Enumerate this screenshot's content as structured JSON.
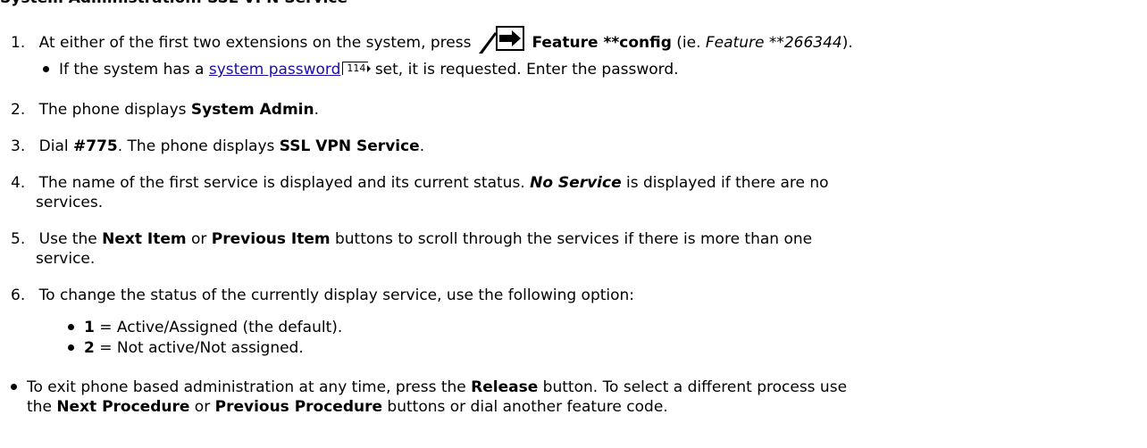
{
  "heading_cut": "System Administration: SSL VPN Service",
  "steps": [
    {
      "num": "1.",
      "pre": "At either of the first two extensions on the system, press",
      "feature_bold": "Feature **config",
      "paren_open": " (ie. ",
      "paren_italic": "Feature **266344",
      "paren_close": ")."
    },
    {
      "num": "2.",
      "pre": "The phone displays ",
      "bold": "System Admin",
      "post": "."
    },
    {
      "num": "3.",
      "pre": "Dial ",
      "bold": "#775",
      "mid": ". The phone displays ",
      "bold2": "SSL VPN Service",
      "post": "."
    },
    {
      "num": "4.",
      "pre": "The name of the first service is displayed and its current status. ",
      "bolditalic": "No Service",
      "post": " is displayed if there are no",
      "line2": "services."
    },
    {
      "num": "5.",
      "pre": "Use the ",
      "bold": "Next Item",
      "mid": " or ",
      "bold2": "Previous Item",
      "post": " buttons to scroll through the services if there is more than one",
      "line2": "service."
    },
    {
      "num": "6.",
      "pre": "To change the status of the currently display service, use the following option:"
    }
  ],
  "password_note": {
    "pre": "If the system has a ",
    "link": "system password",
    "page": "114",
    "post": " set, it is requested. Enter the password."
  },
  "options": [
    {
      "key": "1",
      "text": " = Active/Assigned (the default)."
    },
    {
      "key": "2",
      "text": " = Not active/Not assigned."
    }
  ],
  "exit_note": {
    "pre": "To exit phone based administration at any time, press the ",
    "bold1": "Release",
    "mid1": " button. To select a different process use",
    "line2_pre": "the ",
    "bold2": "Next Procedure",
    "mid2": " or ",
    "bold3": "Previous Procedure",
    "line2_post": " buttons or dial another feature code."
  },
  "icons": {
    "feature_key": "feature-arrow-icon",
    "page_ref": "page-reference-icon"
  },
  "colors": {
    "link": "#1a0dab",
    "text": "#000000",
    "background": "#ffffff"
  }
}
